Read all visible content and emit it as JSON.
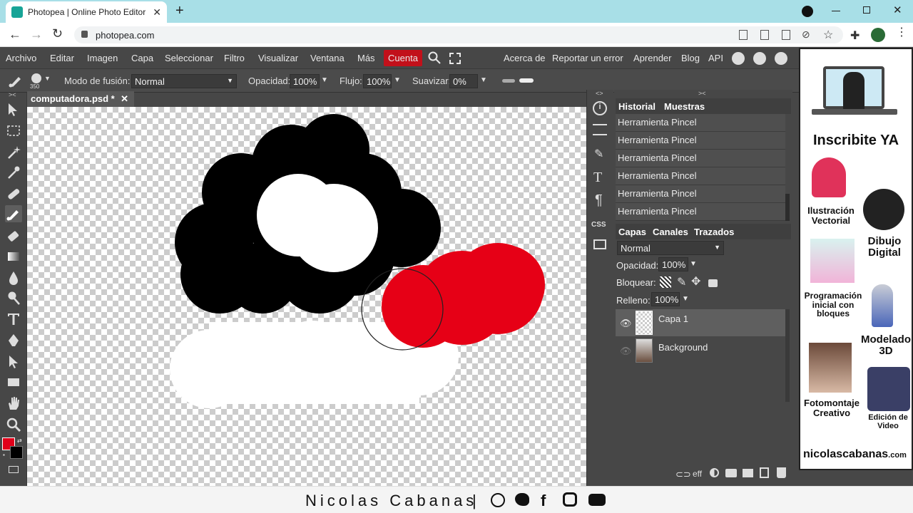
{
  "browser": {
    "tab_title": "Photopea | Online Photo Editor",
    "new_tab": "+",
    "url": "photopea.com"
  },
  "menu": {
    "items": [
      "Archivo",
      "Editar",
      "Imagen",
      "Capa",
      "Seleccionar",
      "Filtro",
      "Visualizar",
      "Ventana",
      "Más",
      "Cuenta"
    ],
    "right": [
      "Acerca de",
      "Reportar un error",
      "Aprender",
      "Blog",
      "API"
    ]
  },
  "options": {
    "brush_size": "350",
    "blend_label": "Modo de fusión:",
    "blend_value": "Normal",
    "opacity_label": "Opacidad:",
    "opacity_value": "100%",
    "flow_label": "Flujo:",
    "flow_value": "100%",
    "smooth_label": "Suavizar:",
    "smooth_value": "0%"
  },
  "document": {
    "tab_label": "computadora.psd *",
    "close": "✕"
  },
  "history": {
    "tabs": [
      "Historial",
      "Muestras"
    ],
    "items": [
      "Herramienta Pincel",
      "Herramienta Pincel",
      "Herramienta Pincel",
      "Herramienta Pincel",
      "Herramienta Pincel",
      "Herramienta Pincel"
    ]
  },
  "layers": {
    "tabs": [
      "Capas",
      "Canales",
      "Trazados"
    ],
    "blend": "Normal",
    "opacity_label": "Opacidad:",
    "opacity_value": "100%",
    "lock_label": "Bloquear:",
    "fill_label": "Relleno:",
    "fill_value": "100%",
    "rows": [
      {
        "name": "Capa 1",
        "selected": true
      },
      {
        "name": "Background",
        "selected": false
      }
    ],
    "footer_eff": "eff"
  },
  "colors": {
    "foreground": "#e0001a",
    "background": "#000000",
    "accent_cuenta": "#c2101a"
  },
  "ad": {
    "headline": "Inscribite YA",
    "topics": [
      "Ilustración Vectorial",
      "Dibujo Digital",
      "Programación inicial con bloques",
      "Modelado 3D",
      "Fotomontaje Creativo",
      "Edición de Video"
    ],
    "brand": "nicolascabanas",
    "brand_suffix": ".com"
  },
  "footer": {
    "credit": "Nicolas Cabanas",
    "separator": "|"
  }
}
